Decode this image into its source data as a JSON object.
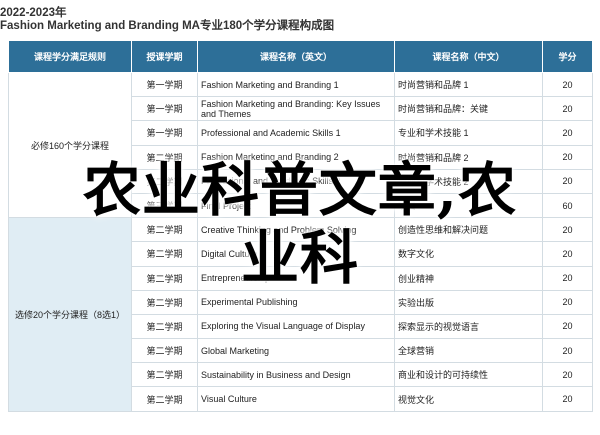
{
  "header": {
    "year": "2022-2023年",
    "title": "Fashion Marketing and Branding MA专业180个学分课程构成图"
  },
  "columns": [
    "课程学分满足规则",
    "授课学期",
    "课程名称（英文）",
    "课程名称（中文）",
    "学分"
  ],
  "categories": [
    {
      "label": "必修160个学分课程"
    },
    {
      "label": "选修20个学分课程（8选1）"
    }
  ],
  "rows": [
    {
      "sem": "第一学期",
      "en": "Fashion Marketing and Branding 1",
      "cn": "时尚营销和品牌 1",
      "credits": "20"
    },
    {
      "sem": "第一学期",
      "en": "Fashion Marketing and Branding: Key Issues and Themes",
      "cn": "时尚营销和品牌：关键",
      "credits": "20"
    },
    {
      "sem": "第一学期",
      "en": "Professional and Academic Skills 1",
      "cn": "专业和学术技能 1",
      "credits": "20"
    },
    {
      "sem": "第二学期",
      "en": "Fashion Marketing and Branding 2",
      "cn": "时尚营销和品牌 2",
      "credits": "20"
    },
    {
      "sem": "第二学期",
      "en": "Professional and Academic Skills 2",
      "cn": "专业和学术技能 2",
      "credits": "20"
    },
    {
      "sem": "第三学期",
      "en": "Final Project",
      "cn": "项目",
      "credits": "60"
    },
    {
      "sem": "第二学期",
      "en": "Creative Thinking and Problem Solving",
      "cn": "创造性思维和解决问题",
      "credits": "20"
    },
    {
      "sem": "第二学期",
      "en": "Digital Culture",
      "cn": "数字文化",
      "credits": "20"
    },
    {
      "sem": "第二学期",
      "en": "Entrepreneurship",
      "cn": "创业精神",
      "credits": "20"
    },
    {
      "sem": "第二学期",
      "en": "Experimental Publishing",
      "cn": "实验出版",
      "credits": "20"
    },
    {
      "sem": "第二学期",
      "en": "Exploring the Visual Language of Display",
      "cn": "探索显示的视觉语言",
      "credits": "20"
    },
    {
      "sem": "第二学期",
      "en": "Global Marketing",
      "cn": "全球营销",
      "credits": "20"
    },
    {
      "sem": "第二学期",
      "en": "Sustainability in Business and Design",
      "cn": "商业和设计的可持续性",
      "credits": "20"
    },
    {
      "sem": "第二学期",
      "en": "Visual Culture",
      "cn": "视觉文化",
      "credits": "20"
    }
  ],
  "overlay": {
    "line1": "农业科普文章,农",
    "line2": "业科"
  }
}
